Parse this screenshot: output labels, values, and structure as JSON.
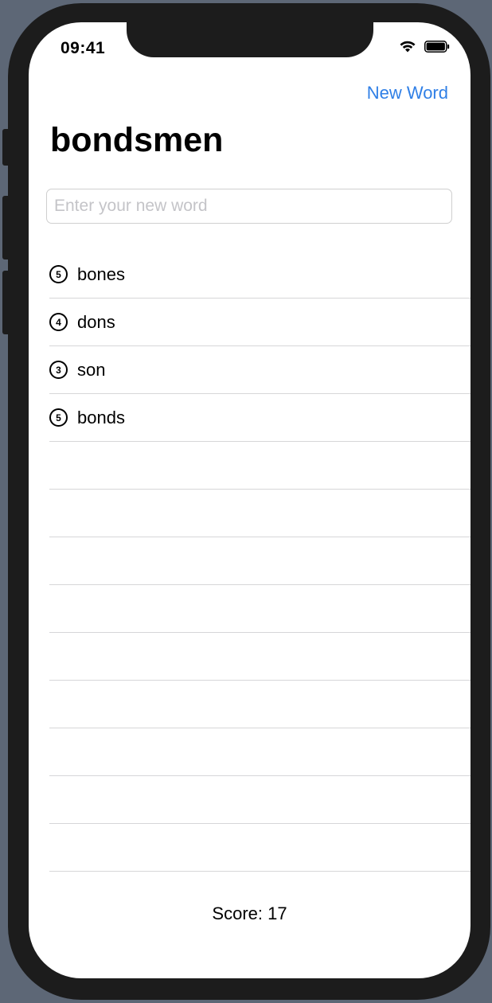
{
  "status": {
    "time": "09:41",
    "icons": [
      "wifi-icon",
      "battery-icon"
    ]
  },
  "nav": {
    "title": "bondsmen",
    "new_word_label": "New Word"
  },
  "input": {
    "placeholder": "Enter your new word",
    "value": ""
  },
  "words": [
    {
      "word": "bones",
      "length": "5"
    },
    {
      "word": "dons",
      "length": "4"
    },
    {
      "word": "son",
      "length": "3"
    },
    {
      "word": "bonds",
      "length": "5"
    }
  ],
  "empty_rows": 9,
  "footer": {
    "score_text": "Score: 17"
  },
  "colors": {
    "accent": "#2f7fe6",
    "separator": "#d6d6d8",
    "device": "#1c1c1c",
    "background": "#5d6776"
  }
}
